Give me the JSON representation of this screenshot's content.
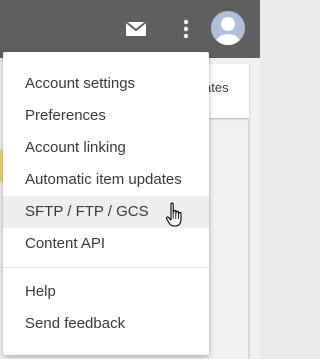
{
  "topbar": {
    "icons": [
      "mail-icon",
      "more-vert-icon",
      "avatar"
    ],
    "background": "#5f5f5f"
  },
  "background_card": {
    "text": "ates"
  },
  "menu": {
    "group1": [
      "Account settings",
      "Preferences",
      "Account linking",
      "Automatic item updates",
      "SFTP / FTP / GCS",
      "Content API"
    ],
    "group2": [
      "Help",
      "Send feedback"
    ],
    "hovered_item": "SFTP / FTP / GCS"
  },
  "colors": {
    "menu_text": "#3a3a3a",
    "hover_bg": "#eeeeee",
    "avatar": "#aebedb"
  }
}
